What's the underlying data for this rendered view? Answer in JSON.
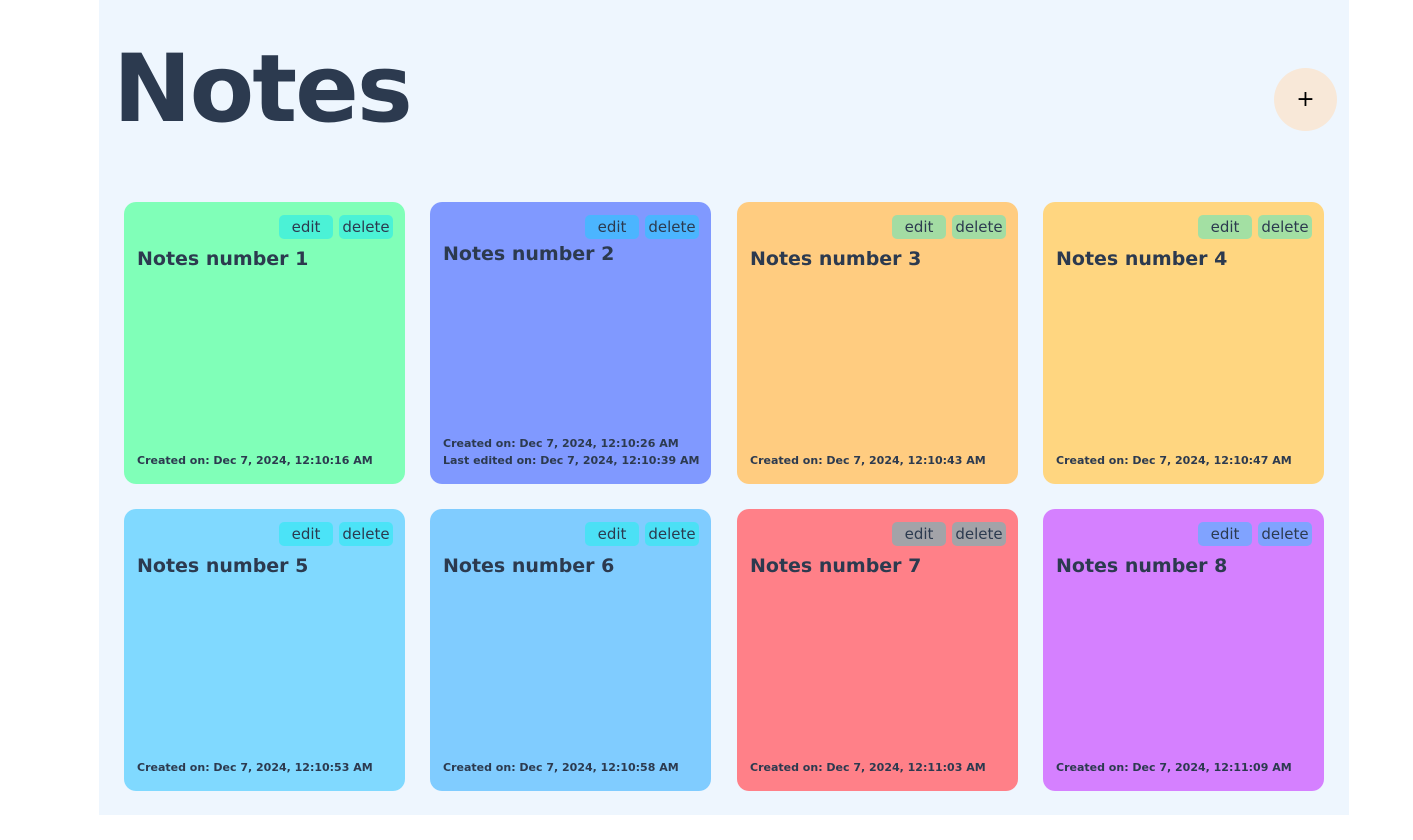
{
  "header": {
    "title": "Notes",
    "add_label": "+"
  },
  "notes": [
    {
      "title": "Notes number 1",
      "created": "Created on: Dec 7, 2024, 12:10:16 AM",
      "edited": "",
      "bg": "#80ffb8",
      "button_bg": "#4bf2d6",
      "edit_label": "edit",
      "delete_label": "delete"
    },
    {
      "title": "Notes number 2",
      "created": "Created on: Dec 7, 2024, 12:10:26 AM",
      "edited": "Last edited on: Dec 7, 2024, 12:10:39 AM",
      "bg": "#8099ff",
      "button_bg": "#4bb5ff",
      "edit_label": "edit",
      "delete_label": "delete"
    },
    {
      "title": "Notes number 3",
      "created": "Created on: Dec 7, 2024, 12:10:43 AM",
      "edited": "",
      "bg": "#ffcc80",
      "button_bg": "#a3dca3",
      "edit_label": "edit",
      "delete_label": "delete"
    },
    {
      "title": "Notes number 4",
      "created": "Created on: Dec 7, 2024, 12:10:47 AM",
      "edited": "",
      "bg": "#ffd680",
      "button_bg": "#a3e0a3",
      "edit_label": "edit",
      "delete_label": "delete"
    },
    {
      "title": "Notes number 5",
      "created": "Created on: Dec 7, 2024, 12:10:53 AM",
      "edited": "",
      "bg": "#80d9ff",
      "button_bg": "#4be3f7",
      "edit_label": "edit",
      "delete_label": "delete"
    },
    {
      "title": "Notes number 6",
      "created": "Created on: Dec 7, 2024, 12:10:58 AM",
      "edited": "",
      "bg": "#80ccff",
      "button_bg": "#4be0f5",
      "edit_label": "edit",
      "delete_label": "delete"
    },
    {
      "title": "Notes number 7",
      "created": "Created on: Dec 7, 2024, 12:11:03 AM",
      "edited": "",
      "bg": "#ff8088",
      "button_bg": "#a3a3a8",
      "edit_label": "edit",
      "delete_label": "delete"
    },
    {
      "title": "Notes number 8",
      "created": "Created on: Dec 7, 2024, 12:11:09 AM",
      "edited": "",
      "bg": "#d580ff",
      "button_bg": "#80a3ff",
      "edit_label": "edit",
      "delete_label": "delete"
    }
  ]
}
